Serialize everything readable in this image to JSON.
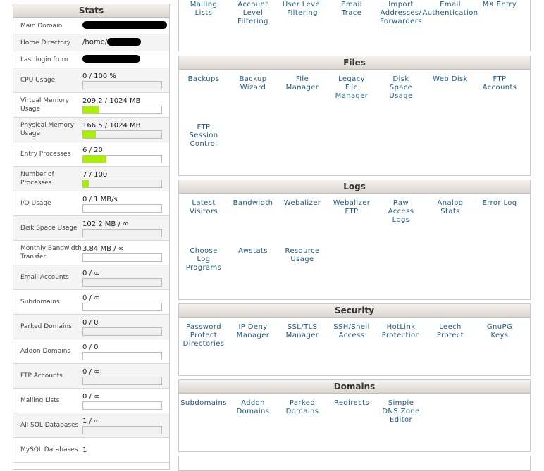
{
  "stats": {
    "title": "Stats",
    "rows": [
      {
        "label": "Main Domain",
        "value": ""
      },
      {
        "label": "Home Directory",
        "value": "/home/"
      },
      {
        "label": "Last login from",
        "value": ""
      },
      {
        "label": "CPU Usage",
        "value": "0 / 100 %",
        "fraction": 0
      },
      {
        "label": "Virtual Memory Usage",
        "value": "209.2 / 1024 MB",
        "fraction": 0.204
      },
      {
        "label": "Physical Memory Usage",
        "value": "166.5 / 1024 MB",
        "fraction": 0.163
      },
      {
        "label": "Entry Processes",
        "value": "6 / 20",
        "fraction": 0.3
      },
      {
        "label": "Number of Processes",
        "value": "7 / 100",
        "fraction": 0.07
      },
      {
        "label": "I/O Usage",
        "value": "0 / 1 MB/s",
        "fraction": 0
      },
      {
        "label": "Disk Space Usage",
        "value": "102.2 MB / ∞",
        "fraction": 0
      },
      {
        "label": "Monthly Bandwidth Transfer",
        "value": "3.84 MB / ∞",
        "fraction": 0
      },
      {
        "label": "Email Accounts",
        "value": "0 / ∞",
        "fraction": 0
      },
      {
        "label": "Subdomains",
        "value": "0 / ∞",
        "fraction": 0
      },
      {
        "label": "Parked Domains",
        "value": "0 / 0",
        "fraction": 0
      },
      {
        "label": "Addon Domains",
        "value": "0 / 0",
        "fraction": 0
      },
      {
        "label": "FTP Accounts",
        "value": "0 / ∞",
        "fraction": 0
      },
      {
        "label": "Mailing Lists",
        "value": "0 / ∞",
        "fraction": 0
      },
      {
        "label": "All SQL Databases",
        "value": "1 / ∞",
        "fraction": 0
      },
      {
        "label": "MySQL Databases",
        "value": "1"
      }
    ]
  },
  "mail_section": {
    "items": [
      "Mailing\nLists",
      "Account\nLevel\nFiltering",
      "User Level\nFiltering",
      "Email\nTrace",
      "Import\nAddresses/\nForwarders",
      "Email\nAuthentication",
      "MX Entry"
    ]
  },
  "files": {
    "title": "Files",
    "items": [
      "Backups",
      "Backup\nWizard",
      "File\nManager",
      "Legacy\nFile\nManager",
      "Disk\nSpace\nUsage",
      "Web Disk",
      "FTP\nAccounts",
      "FTP\nSession\nControl"
    ]
  },
  "logs": {
    "title": "Logs",
    "items": [
      "Latest\nVisitors",
      "Bandwidth",
      "Webalizer",
      "Webalizer\nFTP",
      "Raw\nAccess\nLogs",
      "Analog\nStats",
      "Error Log",
      "Choose\nLog\nPrograms",
      "Awstats",
      "Resource\nUsage"
    ]
  },
  "security": {
    "title": "Security",
    "items": [
      "Password\nProtect\nDirectories",
      "IP Deny\nManager",
      "SSL/TLS\nManager",
      "SSH/Shell\nAccess",
      "HotLink\nProtection",
      "Leech\nProtect",
      "GnuPG\nKeys"
    ]
  },
  "domains": {
    "title": "Domains",
    "items": [
      "Subdomains",
      "Addon\nDomains",
      "Parked\nDomains",
      "Redirects",
      "Simple\nDNS Zone\nEditor"
    ]
  },
  "colors": {
    "bar_fill": "#aaee00",
    "link": "#1a5a8a"
  }
}
